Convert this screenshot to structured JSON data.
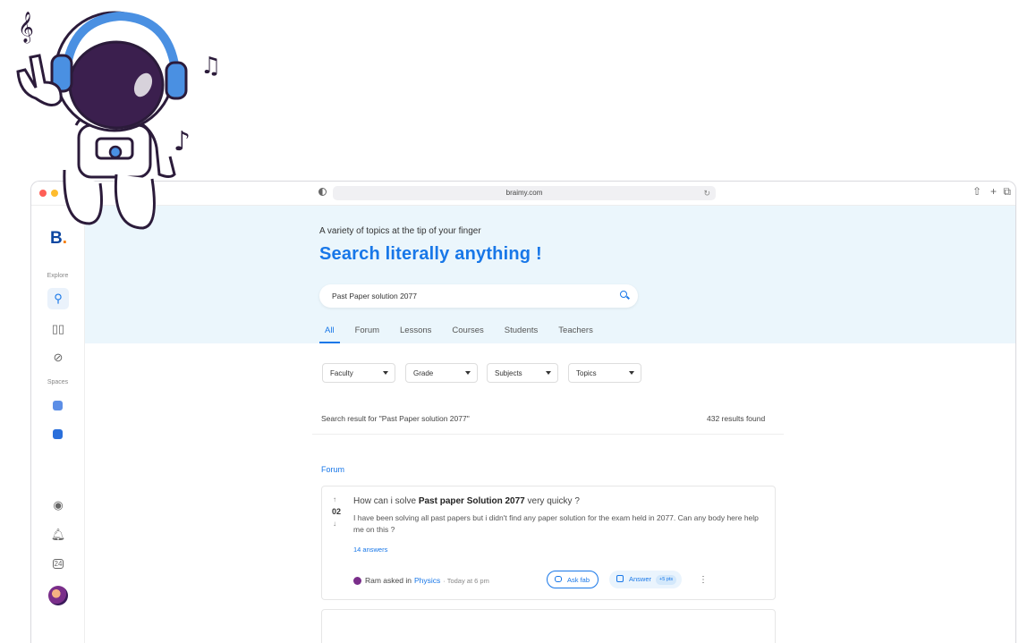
{
  "browser": {
    "url": "braimy.com"
  },
  "sidebar": {
    "logo": "B.",
    "explore_label": "Explore",
    "spaces_label": "Spaces"
  },
  "hero": {
    "subtitle": "A variety of topics at the tip of your finger",
    "title": "Search literally anything !",
    "search_value": "Past Paper solution 2077"
  },
  "tabs": [
    "All",
    "Forum",
    "Lessons",
    "Courses",
    "Students",
    "Teachers"
  ],
  "filters": [
    "Faculty",
    "Grade",
    "Subjects",
    "Topics"
  ],
  "results": {
    "query_text": "Search result for \"Past Paper solution 2077\"",
    "count_text": "432 results found",
    "section": "Forum"
  },
  "question": {
    "votes": "02",
    "title_prefix": "How can i solve ",
    "title_highlight": "Past paper Solution 2077",
    "title_suffix": " very quicky ?",
    "body": "I have been solving all past papers but i didn't find any paper solution for the exam held in 2077. Can any body here help me on this ?",
    "answers": "14 answers",
    "author_text": "Ram asked in",
    "subject": "Physics",
    "time": "· Today at 6 pm",
    "ask_label": "Ask fab",
    "answer_label": "Answer",
    "pts_label": "+5 pts"
  },
  "colors": {
    "accent": "#1877e8",
    "hero_bg": "#ebf6fc",
    "logo": "#0d47a1"
  }
}
